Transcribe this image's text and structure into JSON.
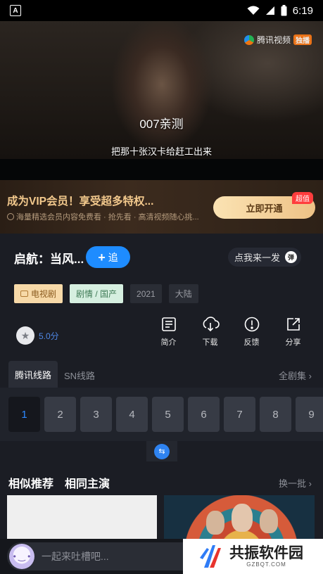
{
  "status_bar": {
    "left_icon": "A",
    "time": "6:19"
  },
  "video": {
    "watermark_brand": "腾讯视频",
    "watermark_badge": "独播",
    "subtitle_1": "007亲测",
    "subtitle_2": "把那十张汉卡给赶工出来"
  },
  "vip_banner": {
    "title": "成为VIP会员！享受超多特权...",
    "subtitle": "海量精选会员内容免费看 · 抢先看 · 高清视频随心挑...",
    "button": "立即开通",
    "badge": "超值"
  },
  "show": {
    "title": "启航：当风...",
    "follow_button": "追",
    "comment_prompt": "点我来一发",
    "danmaku_icon": "弹",
    "tags": {
      "type": "电视剧",
      "genre": "剧情 / 国产",
      "year": "2021",
      "region": "大陆"
    },
    "score": "5.0分",
    "actions": [
      "简介",
      "下载",
      "反馈",
      "分享"
    ]
  },
  "routes": {
    "active": "腾讯线路",
    "other": "SN线路",
    "all_episodes": "全剧集"
  },
  "episodes": [
    "1",
    "2",
    "3",
    "4",
    "5",
    "6",
    "7",
    "8",
    "9"
  ],
  "recommend": {
    "tab_similar": "相似推荐",
    "tab_cast": "相同主演",
    "refresh": "换一批"
  },
  "bottom": {
    "comment_placeholder": "一起来吐槽吧...",
    "logo_name": "共振软件园",
    "logo_url": "GZBQT.COM"
  },
  "colors": {
    "accent": "#1e8cff",
    "vip_gold": "#f3c98d",
    "background": "#1b1d24"
  }
}
